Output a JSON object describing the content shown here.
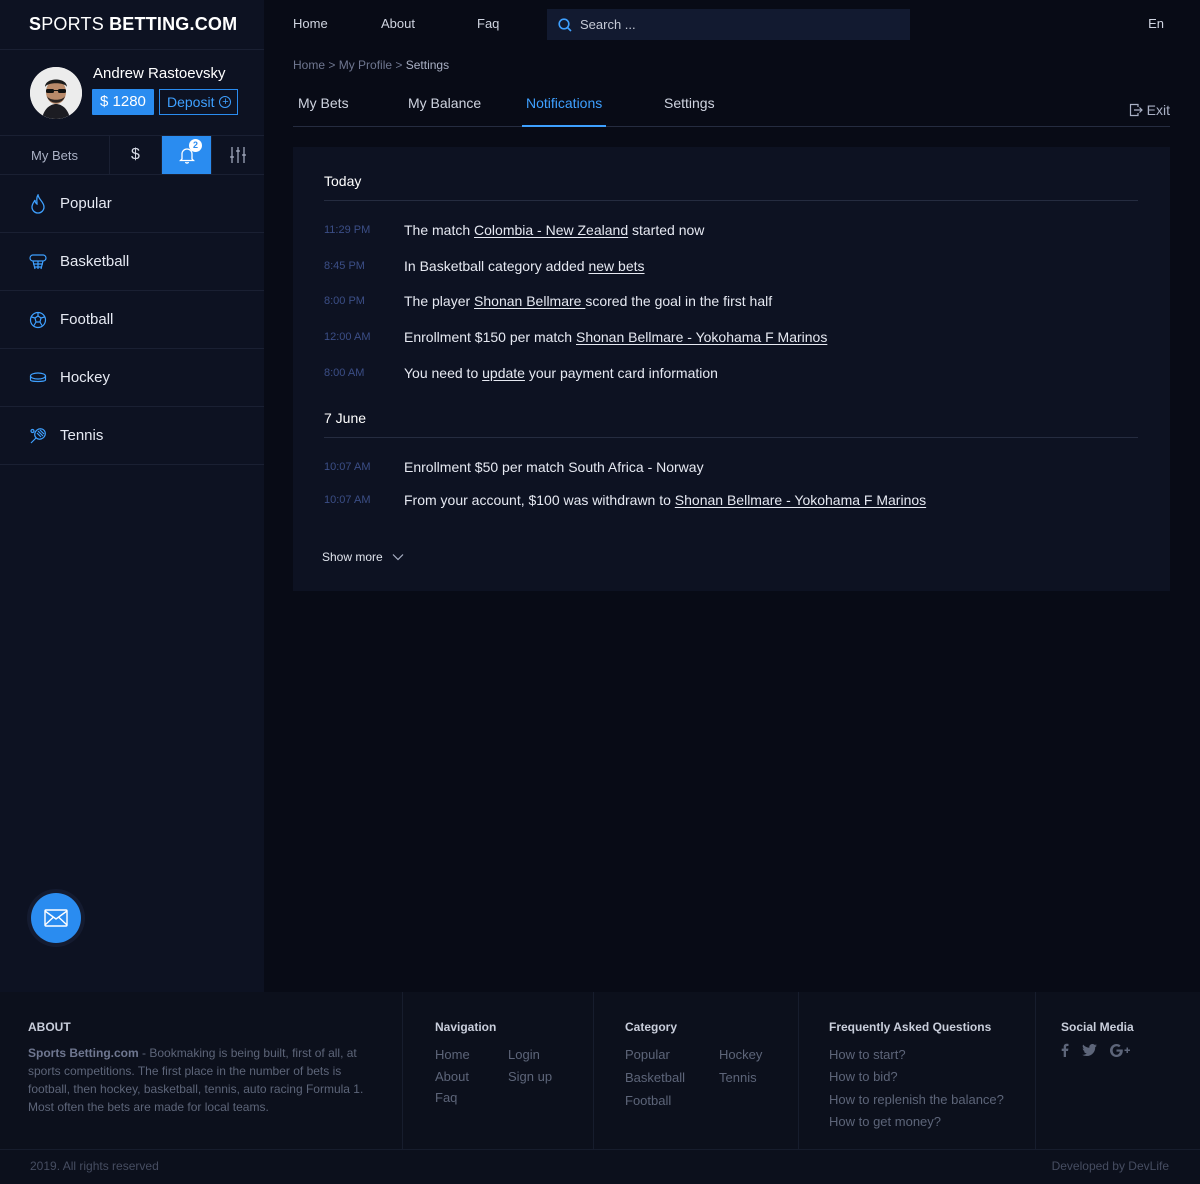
{
  "brand": {
    "part1": "S",
    "part2": "PORTS ",
    "part3": "BETTING.COM"
  },
  "user": {
    "name": "Andrew Rastoevsky",
    "balance": "$ 1280",
    "deposit_label": "Deposit"
  },
  "sidebar_tabs": {
    "my_bets": "My Bets",
    "balance_icon": "$",
    "notif_count": "2"
  },
  "sports": [
    {
      "label": "Popular",
      "icon": "flame-icon"
    },
    {
      "label": "Basketball",
      "icon": "basketball-icon"
    },
    {
      "label": "Football",
      "icon": "football-icon"
    },
    {
      "label": "Hockey",
      "icon": "hockey-puck-icon"
    },
    {
      "label": "Tennis",
      "icon": "tennis-racket-icon"
    }
  ],
  "topnav": {
    "home": "Home",
    "about": "About",
    "faq": "Faq",
    "search_placeholder": "Search ...",
    "lang": "En"
  },
  "breadcrumb": {
    "home": "Home",
    "sep": " > ",
    "profile": "My Profile",
    "current": "Settings"
  },
  "profile_tabs": {
    "my_bets": "My Bets",
    "my_balance": "My Balance",
    "notifications": "Notifications",
    "settings": "Settings",
    "exit": "Exit"
  },
  "notifications": {
    "today_title": "Today",
    "today": [
      {
        "time": "11:29 PM",
        "pre": "The match ",
        "link": "Colombia - New Zealand",
        "post": " started now"
      },
      {
        "time": "8:45 PM",
        "pre": "In Basketball category added ",
        "link": "new bets",
        "post": ""
      },
      {
        "time": "8:00 PM",
        "pre": "The player ",
        "link": "Shonan Bellmare ",
        "post": "scored the goal in the first half"
      },
      {
        "time": "12:00 AM",
        "pre": "Enrollment $150 per match ",
        "link": "Shonan Bellmare - Yokohama F Marinos",
        "post": ""
      },
      {
        "time": "8:00 AM",
        "pre": "You need to ",
        "link": "update",
        "post": " your payment card information"
      }
    ],
    "june_title": "7 June",
    "june": [
      {
        "time": "10:07 AM",
        "pre": "Enrollment $50 per match South Africa - Norway",
        "link": "",
        "post": ""
      },
      {
        "time": "10:07 AM",
        "pre": "From your account, $100 was withdrawn to ",
        "link": "Shonan Bellmare - Yokohama F Marinos",
        "post": ""
      }
    ],
    "show_more": "Show more"
  },
  "footer": {
    "about_title": "ABOUT",
    "about_brand": "Sports Betting.com",
    "about_text": " - Bookmaking is being built, first of all, at sports competitions. The first place in the number of bets is football, then hockey, basketball, tennis, auto racing Formula 1. Most often the bets are made for local teams.",
    "nav_title": "Navigation",
    "nav": {
      "home": "Home",
      "about": "About",
      "faq": "Faq",
      "login": "Login",
      "signup": "Sign up"
    },
    "cat_title": "Category",
    "cat": {
      "popular": "Popular",
      "basketball": "Basketball",
      "football": "Football",
      "hockey": "Hockey",
      "tennis": "Tennis"
    },
    "faq_title": "Frequently Asked Questions",
    "faq": [
      "How to start?",
      "How to bid?",
      "How to replenish the balance?",
      "How to get money?"
    ],
    "social_title": "Social Media",
    "copyright": "2019. All rights reserved",
    "developer": "Developed by DevLife"
  },
  "colors": {
    "accent": "#2a8cf0",
    "bg": "#080b16",
    "panel": "#0d1222"
  }
}
